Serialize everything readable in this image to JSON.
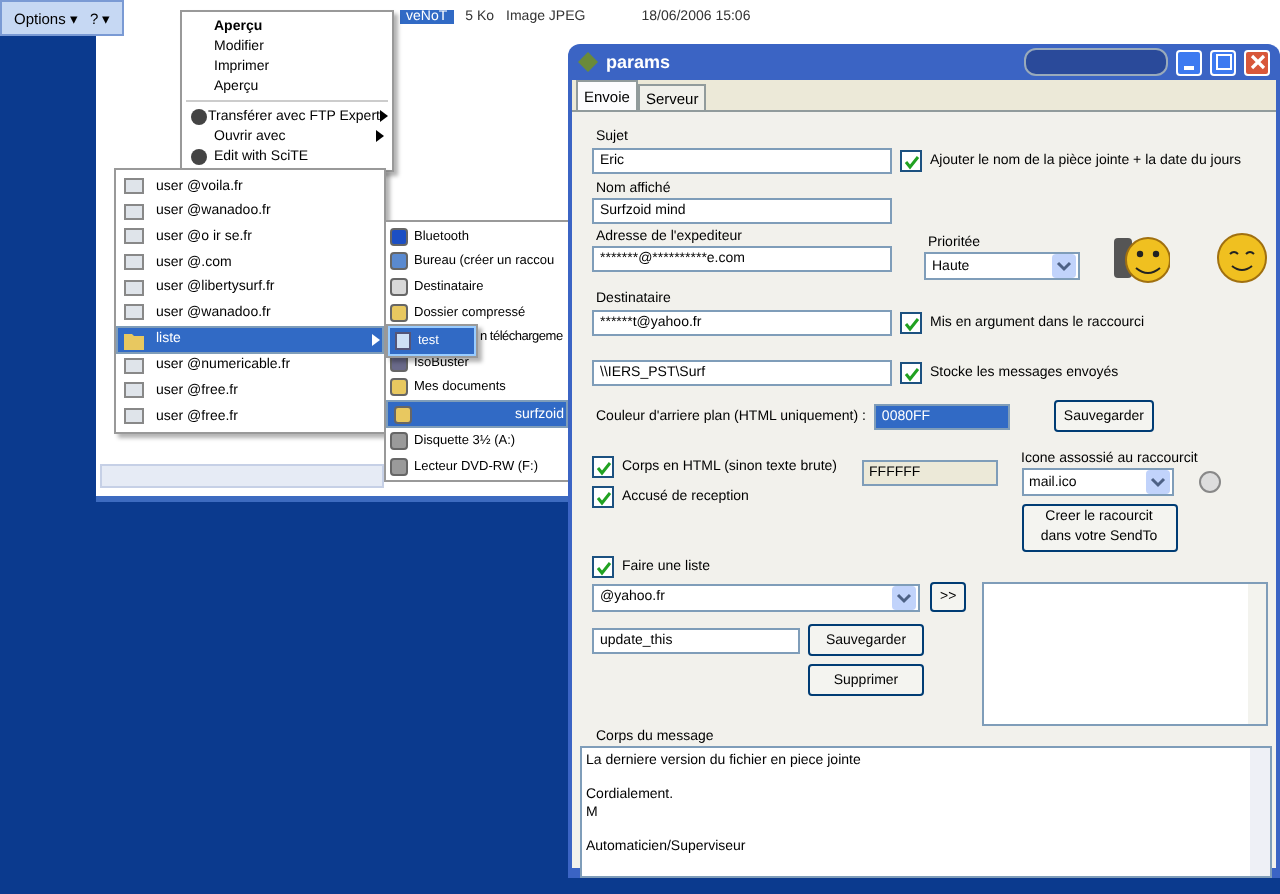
{
  "explorer": {
    "toolbar": [
      {
        "label": "Options",
        "caret": "▾"
      },
      {
        "label": "?",
        "caret": "▾"
      }
    ],
    "file_name": "veNoT",
    "size": "5 Ko",
    "type": "Image JPEG",
    "date": "18/06/2006 15:06"
  },
  "context_menu": [
    {
      "label": "Aperçu",
      "default": true,
      "submenu": false,
      "has_icon": false
    },
    {
      "label": "Modifier",
      "default": false,
      "submenu": false,
      "has_icon": false
    },
    {
      "label": "Imprimer",
      "default": false,
      "submenu": false,
      "has_icon": false
    },
    {
      "label": "Aperçu",
      "default": false,
      "submenu": false,
      "has_icon": false
    },
    {
      "label": "Transférer avec FTP Expert",
      "default": false,
      "submenu": true,
      "has_icon": true
    },
    {
      "label": "Ouvrir avec",
      "default": false,
      "submenu": true,
      "has_icon": false
    },
    {
      "label": "Edit with SciTE",
      "default": false,
      "submenu": false,
      "has_icon": true
    }
  ],
  "recipients_menu": [
    {
      "label": "user @voila.fr",
      "selected": false,
      "submenu": false
    },
    {
      "label": "user @wanadoo.fr",
      "selected": false,
      "submenu": false
    },
    {
      "label": "user @o ir se.fr",
      "selected": false,
      "submenu": false
    },
    {
      "label": "user @.com",
      "selected": false,
      "submenu": false
    },
    {
      "label": "user @libertysurf.fr",
      "selected": false,
      "submenu": false
    },
    {
      "label": "user @wanadoo.fr",
      "selected": false,
      "submenu": false
    },
    {
      "label": "liste",
      "selected": true,
      "submenu": true
    },
    {
      "label": "user @numericable.fr",
      "selected": false,
      "submenu": false
    },
    {
      "label": "user @free.fr",
      "selected": false,
      "submenu": false
    },
    {
      "label": "user @free.fr",
      "selected": false,
      "submenu": false
    }
  ],
  "sendto_menu": [
    {
      "label": "Bluetooth",
      "kind": "bluetooth",
      "selected": false
    },
    {
      "label": "Bureau (créer un raccou",
      "kind": "desktop",
      "selected": false
    },
    {
      "label": "Destinataire",
      "kind": "mail",
      "selected": false
    },
    {
      "label": "Dossier compressé",
      "kind": "folder",
      "selected": false
    },
    {
      "label": "n téléchargeme",
      "kind": "covered",
      "selected": false
    },
    {
      "label": "IsoBuster",
      "kind": "app",
      "selected": false
    },
    {
      "label": "Mes documents",
      "kind": "folder",
      "selected": false
    },
    {
      "label": "surfzoid",
      "kind": "folder",
      "selected": true
    },
    {
      "label": "Disquette 3½ (A:)",
      "kind": "drive",
      "selected": false
    },
    {
      "label": "Lecteur DVD-RW (F:)",
      "kind": "drive",
      "selected": false
    }
  ],
  "list_menu": [
    {
      "label": "test",
      "selected": true
    }
  ],
  "params": {
    "title": "params",
    "tabs": [
      {
        "label": "Envoie",
        "selected": true
      },
      {
        "label": "Serveur",
        "selected": false
      }
    ],
    "subject": {
      "label": "Sujet",
      "value": "Eric"
    },
    "append_name": {
      "label": "Ajouter le nom de la pièce jointe + la date du jours",
      "checked": true
    },
    "display_name": {
      "label": "Nom affiché",
      "value": "Surfzoid mind"
    },
    "sender": {
      "label": "Adresse de l'expediteur",
      "value": "*******@**********e.com"
    },
    "priority": {
      "label": "Prioritée",
      "value": "Haute"
    },
    "recipient": {
      "label": "Destinataire",
      "value": "******t@yahoo.fr"
    },
    "as_argument": {
      "label": "Mis en argument dans le raccourci",
      "checked": true
    },
    "path": {
      "value": "\\\\IERS_PST\\Surf"
    },
    "store_sent": {
      "label": "Stocke les messages envoyés",
      "checked": true
    },
    "bg_color": {
      "label": "Couleur d'arriere plan (HTML uniquement) :",
      "value": "0080FF"
    },
    "save_button": "Sauvegarder",
    "html_body": {
      "label": "Corps en HTML (sinon texte brute)",
      "checked": true
    },
    "receipt": {
      "label": "Accusé de reception",
      "checked": true
    },
    "fg_color": {
      "value": "FFFFFF"
    },
    "shortcut_icon": {
      "label": "Icone assossié au raccourcit",
      "value": "mail.ico"
    },
    "create_shortcut": [
      "Creer le racourcit",
      "dans votre SendTo"
    ],
    "make_list": {
      "label": "Faire une liste",
      "checked": true
    },
    "list_select": {
      "value": "@yahoo.fr"
    },
    "add_button": ">>",
    "list_name": {
      "value": "update_this"
    },
    "list_save": "Sauvegarder",
    "list_delete": "Supprimer",
    "body": {
      "label": "Corps du message",
      "paragraphs": [
        [
          "La derniere version du fichier en piece jointe"
        ],
        [
          "Cordialement.",
          "M"
        ],
        [
          "Automaticien/Superviseur"
        ]
      ]
    }
  }
}
